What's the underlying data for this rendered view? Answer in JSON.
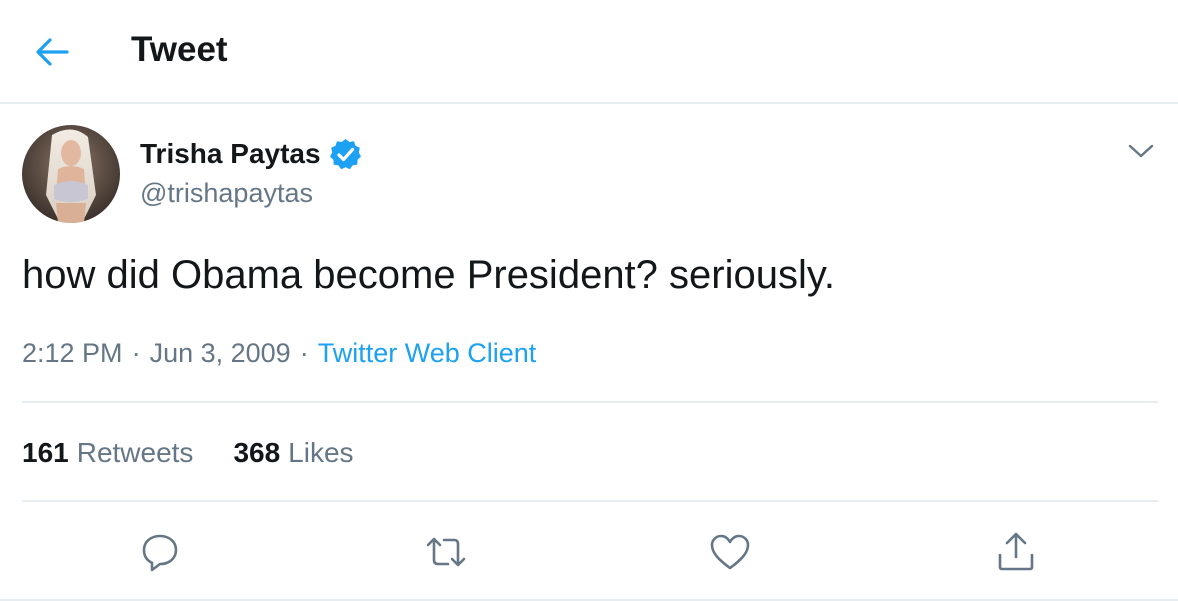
{
  "header": {
    "title": "Tweet",
    "back_icon": "arrow-left-icon"
  },
  "author": {
    "display_name": "Trisha Paytas",
    "handle": "@trishapaytas",
    "verified": true,
    "verified_icon": "verified-badge-icon"
  },
  "tweet": {
    "text": "how did Obama become President? seriously.",
    "time": "2:12 PM",
    "date": "Jun 3, 2009",
    "separator": "·",
    "source": "Twitter Web Client"
  },
  "stats": {
    "retweets_count": "161",
    "retweets_label": "Retweets",
    "likes_count": "368",
    "likes_label": "Likes"
  },
  "actions": [
    {
      "icon": "reply-icon"
    },
    {
      "icon": "retweet-icon"
    },
    {
      "icon": "like-icon"
    },
    {
      "icon": "share-icon"
    }
  ],
  "colors": {
    "accent": "#1da1f2",
    "text_primary": "#14171a",
    "text_secondary": "#657786",
    "divider": "#e6ecf0"
  }
}
